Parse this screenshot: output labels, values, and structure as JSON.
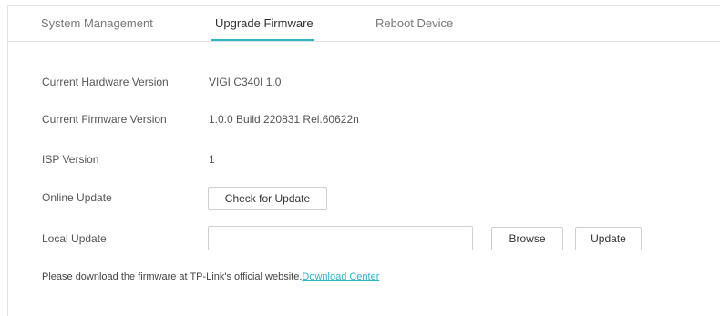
{
  "tabs": [
    {
      "label": "System Management",
      "active": false
    },
    {
      "label": "Upgrade Firmware",
      "active": true
    },
    {
      "label": "Reboot Device",
      "active": false
    }
  ],
  "accent_color": "#2bb5c5",
  "info": {
    "hardware_label": "Current Hardware Version",
    "hardware_value": "VIGI C340I 1.0",
    "firmware_label": "Current Firmware Version",
    "firmware_value": "1.0.0 Build 220831 Rel.60622n",
    "isp_label": "ISP Version",
    "isp_value": "1"
  },
  "online_update": {
    "label": "Online Update",
    "button_label": "Check for Update"
  },
  "local_update": {
    "label": "Local Update",
    "file_value": "",
    "browse_label": "Browse",
    "update_label": "Update"
  },
  "note": {
    "text": "Please download the firmware at TP-Link's official website.",
    "link_text": "Download Center"
  }
}
